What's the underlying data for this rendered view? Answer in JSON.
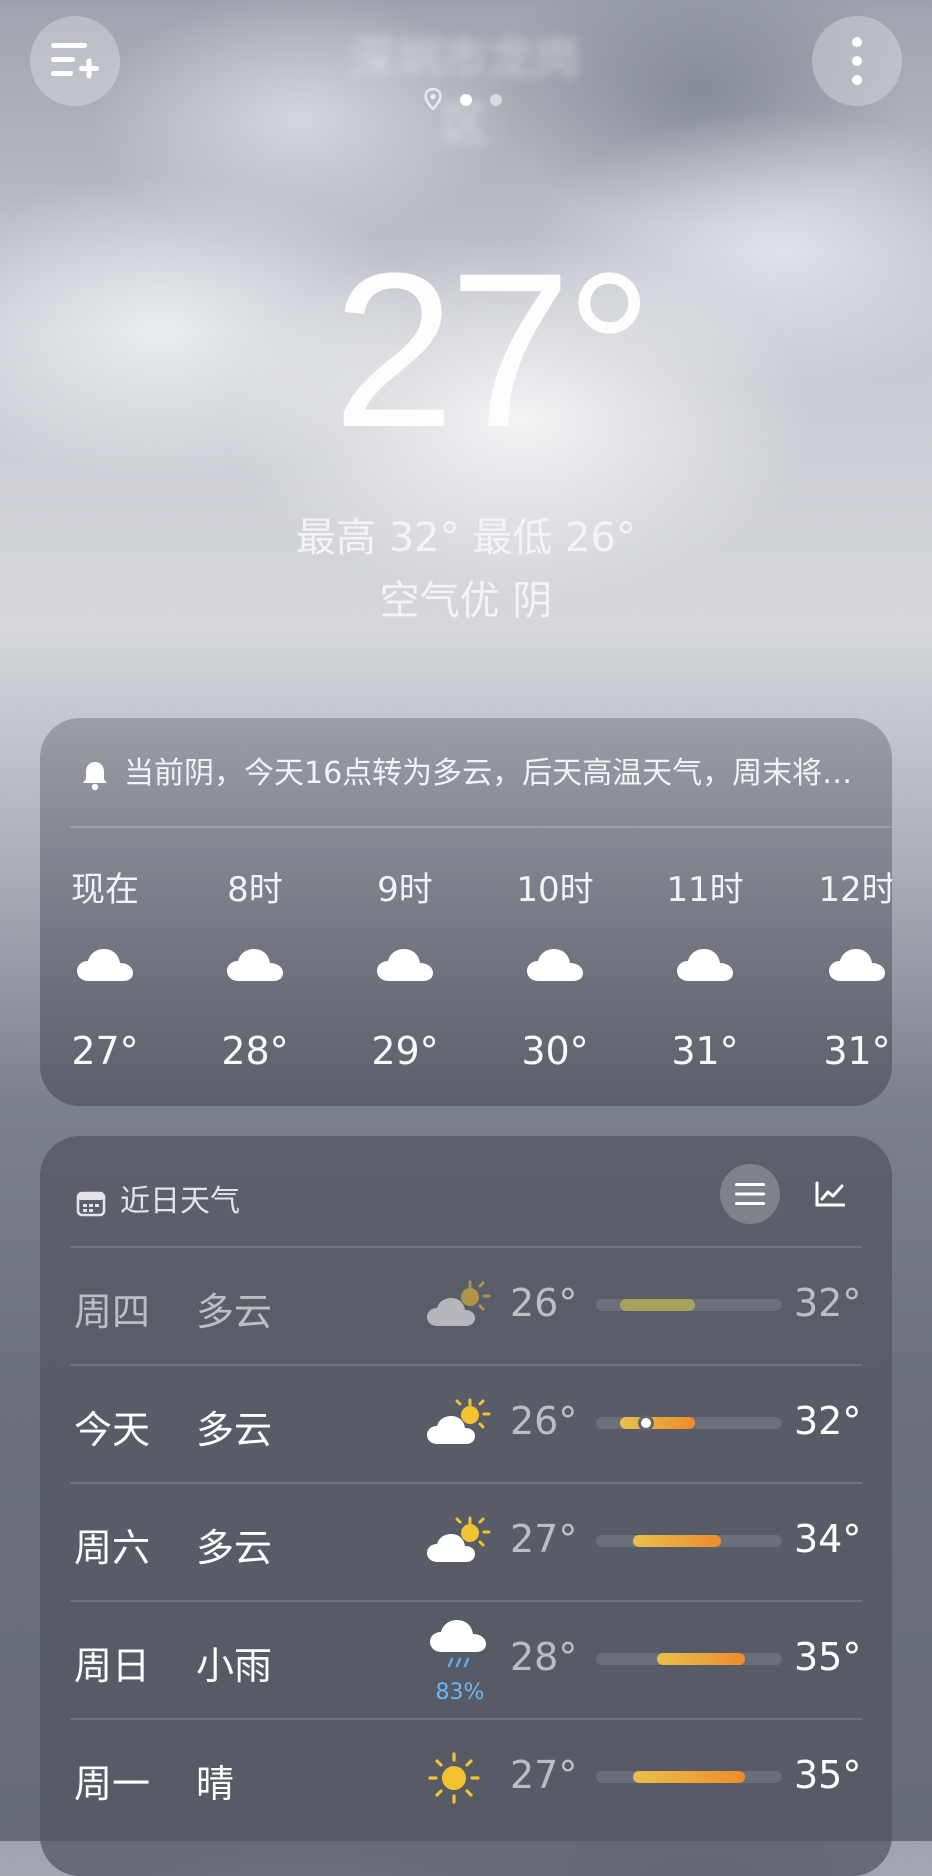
{
  "header": {
    "city": "深圳市龙岗区",
    "page_count": 3,
    "current_page": 1
  },
  "current": {
    "temperature": "27°",
    "hilo": "最高 32° 最低 26°",
    "aqi_condition": "空气优  阴"
  },
  "hourly": {
    "alert": "当前阴，今天16点转为多云，后天高温天气，周末将…",
    "items": [
      {
        "time": "现在",
        "icon": "cloud-icon",
        "temp": "27°"
      },
      {
        "time": "8时",
        "icon": "cloud-icon",
        "temp": "28°"
      },
      {
        "time": "9时",
        "icon": "cloud-icon",
        "temp": "29°"
      },
      {
        "time": "10时",
        "icon": "cloud-icon",
        "temp": "30°"
      },
      {
        "time": "11时",
        "icon": "cloud-icon",
        "temp": "31°"
      },
      {
        "time": "12时",
        "icon": "cloud-icon",
        "temp": "31°"
      }
    ]
  },
  "daily": {
    "title": "近日天气",
    "rows": [
      {
        "day": "周四",
        "condition": "多云",
        "icon": "partly-cloudy-icon",
        "precip": "",
        "low": "26°",
        "high": "32°",
        "past": true,
        "range": [
          0.13,
          0.53
        ],
        "now": null
      },
      {
        "day": "今天",
        "condition": "多云",
        "icon": "partly-cloudy-icon",
        "precip": "",
        "low": "26°",
        "high": "32°",
        "past": false,
        "range": [
          0.13,
          0.53
        ],
        "now": 0.27
      },
      {
        "day": "周六",
        "condition": "多云",
        "icon": "partly-cloudy-icon",
        "precip": "",
        "low": "27°",
        "high": "34°",
        "past": false,
        "range": [
          0.2,
          0.67
        ],
        "now": null
      },
      {
        "day": "周日",
        "condition": "小雨",
        "icon": "rain-icon",
        "precip": "83%",
        "low": "28°",
        "high": "35°",
        "past": false,
        "range": [
          0.33,
          0.8
        ],
        "now": null
      },
      {
        "day": "周一",
        "condition": "晴",
        "icon": "sun-icon",
        "precip": "",
        "low": "27°",
        "high": "35°",
        "past": false,
        "range": [
          0.2,
          0.8
        ],
        "now": null
      }
    ]
  },
  "colors": {
    "bar_start": "#e9c04a",
    "bar_end": "#ec8c2e",
    "past_bar": "#a6a35c",
    "precip": "#6cb7f0"
  }
}
